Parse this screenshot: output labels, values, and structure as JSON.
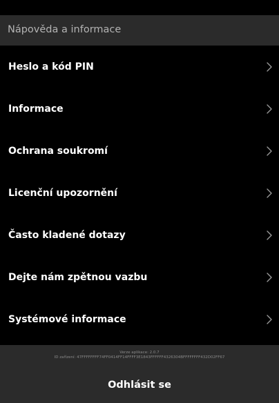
{
  "header": {
    "title": "Nápověda a informace"
  },
  "menu": {
    "items": [
      {
        "label": "Heslo a kód PIN",
        "icon": "chevron-right-icon"
      },
      {
        "label": "Informace",
        "icon": "chevron-right-icon"
      },
      {
        "label": "Ochrana soukromí",
        "icon": "chevron-right-icon"
      },
      {
        "label": "Licenční upozornění",
        "icon": "chevron-right-icon"
      },
      {
        "label": "Často kladené dotazy",
        "icon": "chevron-right-icon"
      },
      {
        "label": "Dejte nám zpětnou vazbu",
        "icon": "chevron-right-icon"
      },
      {
        "label": "Systémové informace",
        "icon": "chevron-right-icon"
      }
    ]
  },
  "footer": {
    "app_version": "Verze aplikace: 2.0.7",
    "device_id": "ID zařízení: 47FFFFFFFF74FF0414FF14FFFF3E1843FFFFFF4326304BFFFFFFFF432D02FF67",
    "logout_label": "Odhlásit se"
  },
  "colors": {
    "background": "#000000",
    "header_background": "#2b2b2b",
    "primary_text": "#ffffff",
    "secondary_text": "#b3b3b3",
    "chevron": "#9a9a9a"
  }
}
